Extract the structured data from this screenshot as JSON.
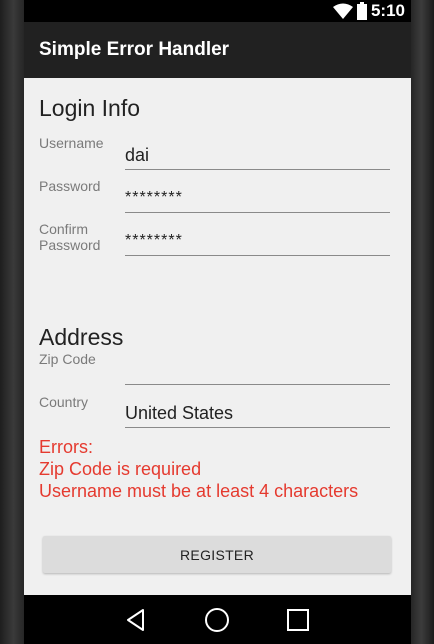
{
  "status_bar": {
    "time": "5:10",
    "icons": [
      "wifi-icon",
      "battery-icon"
    ]
  },
  "app_bar": {
    "title": "Simple Error Handler"
  },
  "login_info": {
    "title": "Login Info",
    "username_label": "Username",
    "username_value": "dai",
    "password_label": "Password",
    "password_value": "********",
    "confirm_label_line1": "Confirm",
    "confirm_label_line2": "Password",
    "confirm_value": "********"
  },
  "address": {
    "title": "Address",
    "zip_label": "Zip Code",
    "zip_value": "",
    "country_label": "Country",
    "country_value": "United States"
  },
  "errors": {
    "heading": "Errors:",
    "messages": [
      "Zip Code is required",
      "Username must be at least 4 characters"
    ]
  },
  "register_button_label": "REGISTER",
  "nav_bar": {
    "icons": [
      "back-icon",
      "home-icon",
      "recents-icon"
    ]
  },
  "colors": {
    "status_bar": "#000000",
    "app_bar": "#212121",
    "background": "#f0f0f0",
    "error_text": "#e53a2f",
    "button": "#dcdcdc"
  }
}
